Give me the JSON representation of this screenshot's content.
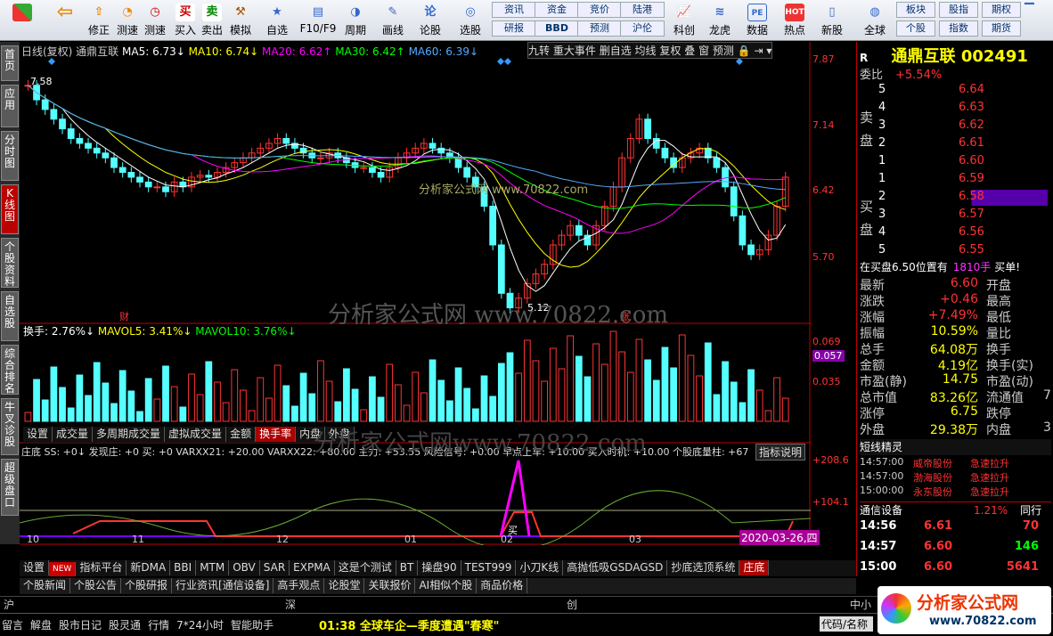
{
  "toolbar": {
    "buttons": [
      "",
      "",
      "修正",
      "测速",
      "买入",
      "卖出",
      "模拟",
      "自选",
      "F10/F9",
      "周期",
      "画线",
      "论股",
      "选股"
    ],
    "grid": [
      "资讯",
      "资金",
      "竞价",
      "陆港",
      "研报",
      "BBD",
      "预测",
      "沪伦"
    ],
    "right_buttons": [
      "科创",
      "龙虎",
      "数据",
      "热点",
      "新股",
      "全球"
    ],
    "far": [
      "板块",
      "股指",
      "期权",
      "个股",
      "指数",
      "期货"
    ]
  },
  "leftnav": [
    "首页",
    "应用",
    "分时图",
    "K线图",
    "个股资料",
    "自选股",
    "综合排名",
    "牛叉诊股",
    "超级盘口"
  ],
  "chart": {
    "header": {
      "name": "日线(复权) 通鼎互联",
      "ma5": "MA5: 6.73↓",
      "ma10": "MA10: 6.74↓",
      "ma20": "MA20: 6.62↑",
      "ma30": "MA30: 6.42↑",
      "ma60": "MA60: 6.39↓"
    },
    "top_buttons": [
      "九转",
      "重大事件",
      "删自选",
      "均线",
      "复权",
      "叠",
      "窗",
      "预测"
    ],
    "price_axis": [
      "7.87",
      "7.14",
      "6.42",
      "5.70"
    ],
    "hi_label": "7.58",
    "lo_label": "5.12",
    "fin": "财",
    "zhang": "涨",
    "watermark": "分析家公式网 www.70822.com",
    "watermark2": "分析家公式网www.70822.com",
    "vol_header": {
      "a": "换手: 2.76%↓",
      "b": "MAVOL5: 3.41%↓",
      "c": "MAVOL10: 3.76%↓"
    },
    "vol_axis": [
      "0.069",
      "0.057",
      "0.035"
    ],
    "vol_tabs": [
      "设置",
      "成交量",
      "多周期成交量",
      "虚拟成交量",
      "金额",
      "换手率",
      "内盘",
      "外盘"
    ],
    "ind_header": "庄底 SS: +0↓ 发现庄: +0  买: +0  VARXX21: +20.00  VARXX22: +80.00  主力: +53.55  风险信号: +0.00  早点上车: +10.00  买入时机: +10.00  个股底量柱: +67",
    "ind_btn": "指标说明",
    "ind_axis": [
      "+208.6",
      "+104.1"
    ],
    "months": [
      "10",
      "11",
      "12",
      "01",
      "02",
      "03"
    ],
    "date_tag": "2020-03-26,四",
    "buy": "买"
  },
  "bottom_tabs": [
    "设置",
    "NEW",
    "指标平台",
    "新DMA",
    "BBI",
    "MTM",
    "OBV",
    "SAR",
    "EXPMA",
    "这是个测试",
    "BT",
    "操盘90",
    "TEST999",
    "小刀K线",
    "高抛低吸GSDAGSD",
    "抄底选顶系统",
    "庄底"
  ],
  "news_tabs": [
    "个股新闻",
    "个股公告",
    "个股研报",
    "行业资讯[通信设备]",
    "高手观点",
    "论股堂",
    "关联报价",
    "AI相似个股",
    "商品价格"
  ],
  "index_bar": [
    "沪",
    "深",
    "创",
    "中小"
  ],
  "status": {
    "items": [
      "留言",
      "解盘",
      "股市日记",
      "股灵通",
      "行情",
      "7*24小时",
      "智能助手"
    ],
    "news": "01:38 全球车企—季度遭遇\"春寒\"",
    "code": "代码/名称"
  },
  "quote": {
    "r": "R",
    "name": "通鼎互联",
    "code": "002491",
    "weibi_label": "委比",
    "weibi": "+5.54%",
    "sell": [
      [
        "5",
        "6.64"
      ],
      [
        "4",
        "6.63"
      ],
      [
        "3",
        "6.62"
      ],
      [
        "2",
        "6.61"
      ],
      [
        "1",
        "6.60"
      ]
    ],
    "buy": [
      [
        "1",
        "6.59"
      ],
      [
        "2",
        "6.58"
      ],
      [
        "3",
        "6.57"
      ],
      [
        "4",
        "6.56"
      ],
      [
        "5",
        "6.55"
      ]
    ],
    "sell_label": [
      "卖",
      "盘"
    ],
    "buy_label": [
      "买",
      "盘"
    ],
    "note": "在买盘6.50位置有",
    "note_vol": "1810手",
    "note_end": "买单!",
    "stats": [
      [
        "最新",
        "6.60",
        "开盘",
        ""
      ],
      [
        "涨跌",
        "+0.46",
        "最高",
        ""
      ],
      [
        "涨幅",
        "+7.49%",
        "最低",
        ""
      ],
      [
        "振幅",
        "10.59%",
        "量比",
        ""
      ],
      [
        "总手",
        "64.08万",
        "换手",
        ""
      ],
      [
        "金额",
        "4.19亿",
        "换手(实)",
        ""
      ],
      [
        "市盈(静)",
        "14.75",
        "市盈(动)",
        ""
      ],
      [
        "总市值",
        "83.26亿",
        "流通值",
        "7"
      ],
      [
        "涨停",
        "6.75",
        "跌停",
        ""
      ],
      [
        "外盘",
        "29.38万",
        "内盘",
        "3"
      ]
    ],
    "elf_title": "短线精灵",
    "elf": [
      [
        "14:57:00",
        "威帝股份",
        "急速拉升"
      ],
      [
        "14:57:00",
        "渤海股份",
        "急速拉升"
      ],
      [
        "15:00:00",
        "永东股份",
        "急速拉升"
      ]
    ],
    "industry": "通信设备",
    "industry_pct": "1.21%",
    "industry_same": "同行",
    "ticks": [
      [
        "14:56",
        "6.61",
        "70"
      ],
      [
        "14:57",
        "6.60",
        "146"
      ],
      [
        "15:00",
        "6.60",
        "5641"
      ]
    ],
    "logo": "分析家公式网",
    "logo_url": "www.70822.com"
  },
  "chart_data": {
    "type": "candlestick",
    "note_series": [
      "MA5",
      "MA10",
      "MA20",
      "MA30",
      "MA60"
    ],
    "ylim": [
      5.2,
      7.87
    ],
    "last": 6.6
  }
}
